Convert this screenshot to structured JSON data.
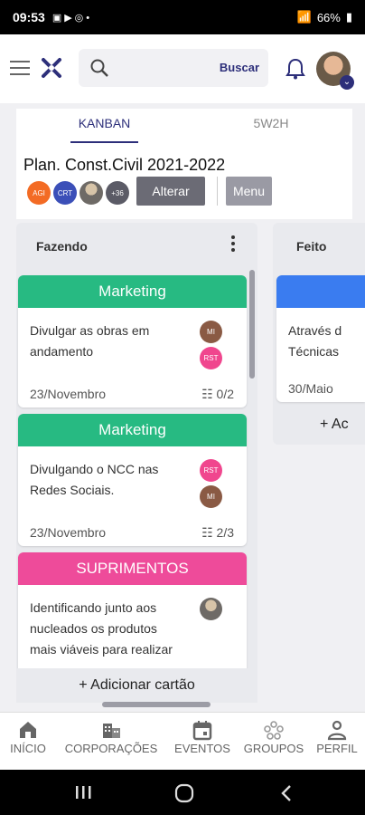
{
  "status": {
    "time": "09:53",
    "battery": "66%"
  },
  "search": {
    "button": "Buscar"
  },
  "tabs": [
    {
      "label": "KANBAN"
    },
    {
      "label": "5W2H"
    }
  ],
  "project": {
    "title": "Plan. Const.Civil 2021-2022",
    "members": [
      {
        "initials": "AGI",
        "color": "#f36b24"
      },
      {
        "initials": "CRT",
        "color": "#3b4fb8"
      },
      {
        "initials": "",
        "color": "#a08060"
      },
      {
        "initials": "+36",
        "color": "#5b5b66"
      }
    ],
    "alterar": "Alterar",
    "menu": "Menu"
  },
  "columns": [
    {
      "title": "Fazendo",
      "add_card": "+ Adicionar cartão",
      "cards": [
        {
          "header": "Marketing",
          "header_color": "#27ba82",
          "text": "Divulgar as obras em andamento",
          "date": "23/Novembro",
          "checklist": "0/2",
          "avatars": [
            {
              "initials": "MI",
              "color": "#8a5a44"
            },
            {
              "initials": "RST",
              "color": "#f0468e"
            }
          ]
        },
        {
          "header": "Marketing",
          "header_color": "#27ba82",
          "text": "Divulgando o NCC nas Redes Sociais.",
          "date": "23/Novembro",
          "checklist": "2/3",
          "avatars": [
            {
              "initials": "RST",
              "color": "#f0468e"
            },
            {
              "initials": "MI",
              "color": "#8a5a44"
            }
          ]
        },
        {
          "header": "SUPRIMENTOS",
          "header_color": "#ee4b9a",
          "text": "Identificando junto aos nucleados os produtos mais viáveis para realizar",
          "avatars": [
            {
              "initials": "",
              "color": "#7a6a5a"
            }
          ]
        }
      ]
    },
    {
      "title": "Feito",
      "add_card": "+ Ac",
      "cards": [
        {
          "header_color": "#3a7cf0",
          "text": "Através d Técnicas",
          "date": "30/Maio"
        }
      ]
    }
  ],
  "nav": [
    {
      "label": "INÍCIO",
      "icon": "home-icon"
    },
    {
      "label": "CORPORAÇÕES",
      "icon": "building-icon"
    },
    {
      "label": "EVENTOS",
      "icon": "calendar-icon"
    },
    {
      "label": "GROUPOS",
      "icon": "groups-icon"
    },
    {
      "label": "PERFIL",
      "icon": "person-icon"
    }
  ]
}
